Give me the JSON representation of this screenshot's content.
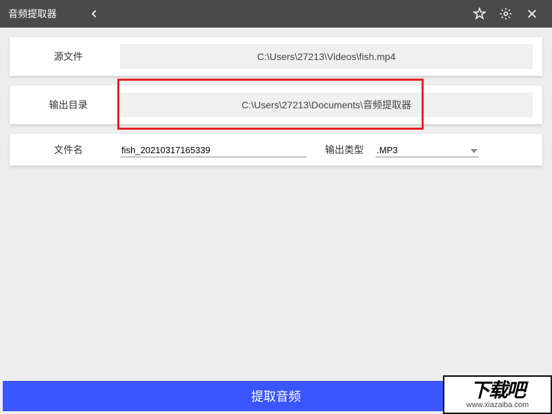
{
  "header": {
    "title": "音频提取器"
  },
  "source": {
    "label": "源文件",
    "value": "C:\\Users\\27213\\Videos\\fish.mp4"
  },
  "outputDir": {
    "label": "输出目录",
    "value": "C:\\Users\\27213\\Documents\\音频提取器"
  },
  "filename": {
    "label": "文件名",
    "value": "fish_20210317165339"
  },
  "outputType": {
    "label": "输出类型",
    "value": ".MP3"
  },
  "extractButton": "提取音频",
  "watermark": {
    "title": "下载吧",
    "url": "www.xiazaiba.com"
  }
}
